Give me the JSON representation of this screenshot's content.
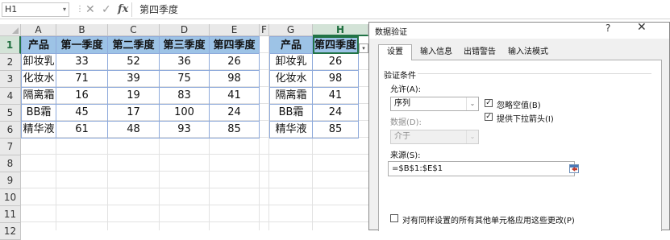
{
  "formula_bar": {
    "name_box": "H1",
    "name_box_dropdown": "▾",
    "separator": "⋮",
    "cancel_glyph": "✕",
    "enter_glyph": "✓",
    "fx_glyph": "fx",
    "content": "第四季度"
  },
  "columns": [
    "A",
    "B",
    "C",
    "D",
    "E",
    "F",
    "G",
    "H"
  ],
  "rows": [
    "1",
    "2",
    "3",
    "4",
    "5",
    "6",
    "7",
    "8",
    "9",
    "10",
    "11",
    "12"
  ],
  "table1": {
    "headers": [
      "产品",
      "第一季度",
      "第二季度",
      "第三季度",
      "第四季度"
    ],
    "rows": [
      [
        "卸妆乳",
        "33",
        "52",
        "36",
        "26"
      ],
      [
        "化妆水",
        "71",
        "39",
        "75",
        "98"
      ],
      [
        "隔离霜",
        "16",
        "19",
        "83",
        "41"
      ],
      [
        "BB霜",
        "45",
        "17",
        "100",
        "24"
      ],
      [
        "精华液",
        "61",
        "48",
        "93",
        "85"
      ]
    ]
  },
  "table2": {
    "headers": [
      "产品",
      "第四季度"
    ],
    "rows": [
      [
        "卸妆乳",
        "26"
      ],
      [
        "化妆水",
        "98"
      ],
      [
        "隔离霜",
        "41"
      ],
      [
        "BB霜",
        "24"
      ],
      [
        "精华液",
        "85"
      ]
    ]
  },
  "dropdown_arrow": "▾",
  "dialog": {
    "title": "数据验证",
    "help": "?",
    "close": "✕",
    "tabs": [
      "设置",
      "输入信息",
      "出错警告",
      "输入法模式"
    ],
    "active_tab": "设置",
    "group_label": "验证条件",
    "allow_label": "允许(A):",
    "allow_value": "序列",
    "data_label": "数据(D):",
    "data_value": "介于",
    "combo_arrow": "⌄",
    "ignore_blank": "忽略空值(B)",
    "in_cell_dropdown": "提供下拉箭头(I)",
    "checkmark": "✓",
    "source_label": "来源(S):",
    "source_value": "=$B$1:$E$1",
    "apply_all": "对有同样设置的所有其他单元格应用这些更改(P)"
  },
  "colors": {
    "header_fill": "#9dc3e6",
    "table_border": "#8eaadb",
    "excel_green": "#217346"
  }
}
